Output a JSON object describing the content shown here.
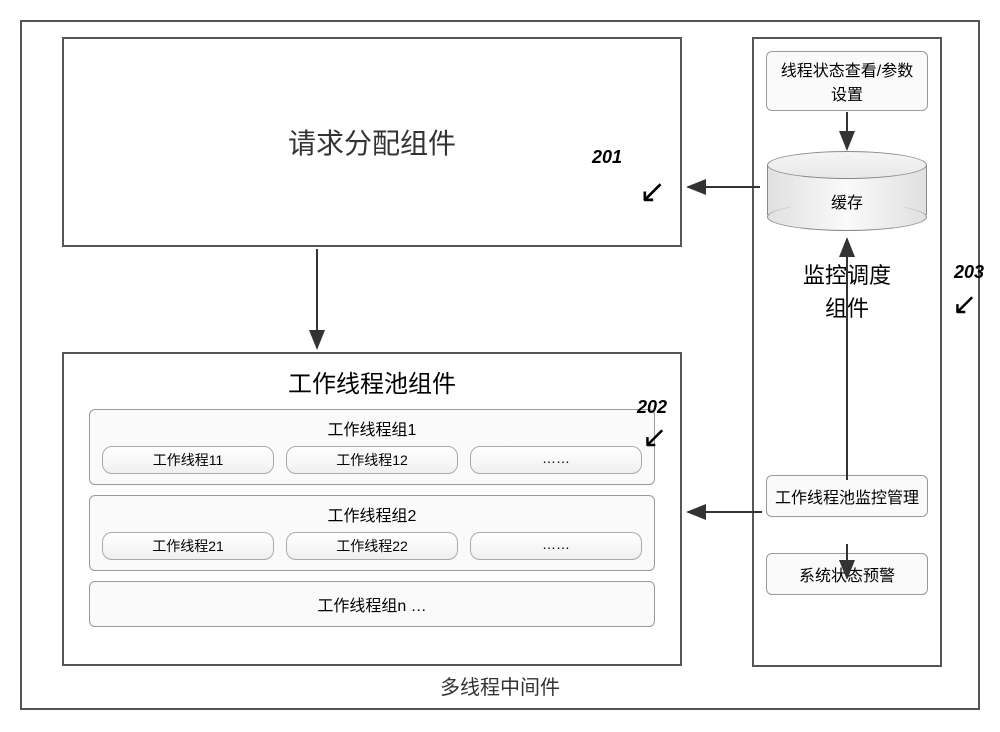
{
  "outer_label": "多线程中间件",
  "request_component": "请求分配组件",
  "labels": {
    "l201": "201",
    "l202": "202",
    "l203": "203"
  },
  "worker_pool": {
    "title": "工作线程池组件",
    "group1": {
      "title": "工作线程组1",
      "t1": "工作线程11",
      "t2": "工作线程12",
      "t3": "……"
    },
    "group2": {
      "title": "工作线程组2",
      "t1": "工作线程21",
      "t2": "工作线程22",
      "t3": "……"
    },
    "groupn": "工作线程组n …"
  },
  "monitor": {
    "status_view": "线程状态查看/参数设置",
    "cache": "缓存",
    "title_line1": "监控调度",
    "title_line2": "组件",
    "pool_monitor": "工作线程池监控管理",
    "alert": "系统状态预警"
  }
}
